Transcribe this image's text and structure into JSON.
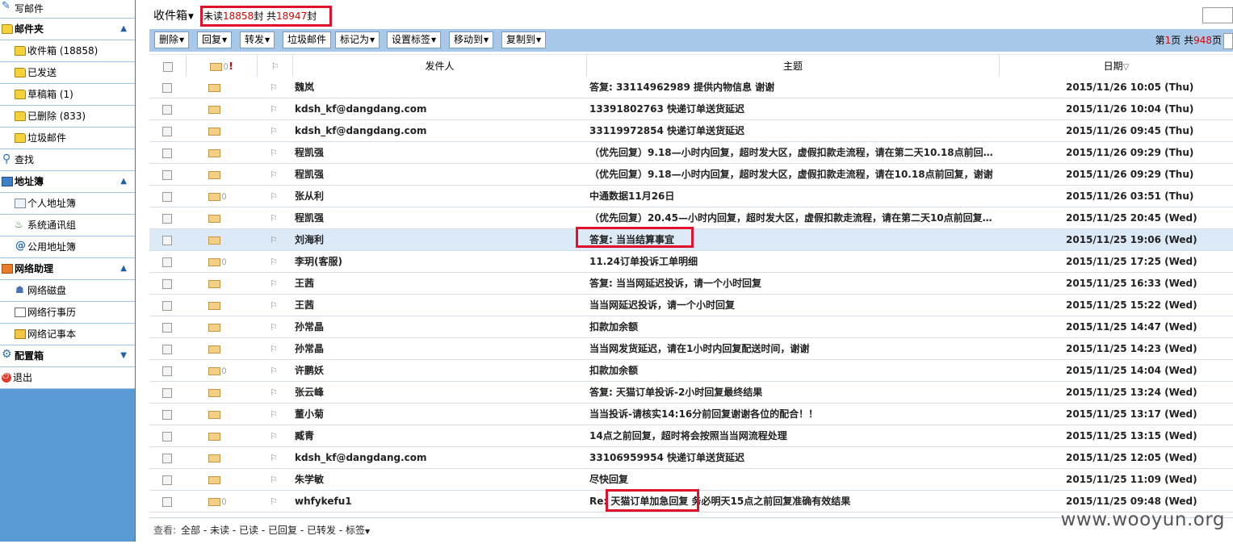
{
  "sidebar": {
    "compose": "写邮件",
    "folders_header": "邮件夹",
    "folders": [
      "收件箱 (18858)",
      "已发送",
      "草稿箱 (1)",
      "已删除 (833)",
      "垃圾邮件"
    ],
    "search": "查找",
    "addressbook_header": "地址簿",
    "addressbook": [
      "个人地址簿",
      "系统通讯组",
      "公用地址簿"
    ],
    "netassist_header": "网络助理",
    "netassist": [
      "网络磁盘",
      "网络行事历",
      "网络记事本"
    ],
    "config_header": "配置箱",
    "logout": "退出"
  },
  "header": {
    "title": "收件箱",
    "unread_prefix": "未读",
    "unread_count": "18858",
    "unread_mid": "封 共",
    "total_count": "18947",
    "total_suffix": "封"
  },
  "toolbar": {
    "delete": "删除",
    "reply": "回复",
    "forward": "转发",
    "spam": "垃圾邮件",
    "mark_as": "标记为",
    "set_tag": "设置标签",
    "move_to": "移动到",
    "copy_to": "复制到",
    "page_prefix": "第",
    "page_num": "1",
    "page_mid": "页 共",
    "page_total": "948",
    "page_suffix": "页"
  },
  "columns": {
    "sender": "发件人",
    "subject": "主题",
    "date": "日期"
  },
  "rows": [
    {
      "from": "魏岚",
      "subject": "答复: 33114962989 提供内物信息 谢谢",
      "date": "2015/11/26 10:05 (Thu)",
      "attach": false
    },
    {
      "from": "kdsh_kf@dangdang.com",
      "subject": "13391802763 快递订单送货延迟",
      "date": "2015/11/26 10:04 (Thu)",
      "attach": false
    },
    {
      "from": "kdsh_kf@dangdang.com",
      "subject": "33119972854 快递订单送货延迟",
      "date": "2015/11/26 09:45 (Thu)",
      "attach": false
    },
    {
      "from": "程凯强",
      "subject": "（优先回复）9.18—小时内回复，超时发大区，虚假扣款走流程，请在第二天10.18点前回...",
      "date": "2015/11/26 09:29 (Thu)",
      "attach": false
    },
    {
      "from": "程凯强",
      "subject": "（优先回复）9.18—小时内回复，超时发大区，虚假扣款走流程，请在10.18点前回复，谢谢",
      "date": "2015/11/26 09:29 (Thu)",
      "attach": false
    },
    {
      "from": "张从利",
      "subject": "中通数据11月26日",
      "date": "2015/11/26 03:51 (Thu)",
      "attach": true
    },
    {
      "from": "程凯强",
      "subject": "（优先回复）20.45—小时内回复，超时发大区，虚假扣款走流程，请在第二天10点前回复...",
      "date": "2015/11/25 20:45 (Wed)",
      "attach": false
    },
    {
      "from": "刘海利",
      "subject": "答复: 当当结算事宜",
      "date": "2015/11/25 19:06 (Wed)",
      "attach": false
    },
    {
      "from": "李玥(客服)",
      "subject": "11.24订单投诉工单明细",
      "date": "2015/11/25 17:25 (Wed)",
      "attach": true
    },
    {
      "from": "王茜",
      "subject": "答复: 当当网延迟投诉，请一个小时回复",
      "date": "2015/11/25 16:33 (Wed)",
      "attach": false
    },
    {
      "from": "王茜",
      "subject": "当当网延迟投诉，请一个小时回复",
      "date": "2015/11/25 15:22 (Wed)",
      "attach": false
    },
    {
      "from": "孙常晶",
      "subject": "扣款加余额",
      "date": "2015/11/25 14:47 (Wed)",
      "attach": false
    },
    {
      "from": "孙常晶",
      "subject": "当当网发货延迟，请在1小时内回复配送时间，谢谢",
      "date": "2015/11/25 14:23 (Wed)",
      "attach": false
    },
    {
      "from": "许鹏妖",
      "subject": "扣款加余额",
      "date": "2015/11/25 14:04 (Wed)",
      "attach": true
    },
    {
      "from": "张云峰",
      "subject": "答复: 天猫订单投诉-2小时回复最终结果",
      "date": "2015/11/25 13:24 (Wed)",
      "attach": false
    },
    {
      "from": "董小菊",
      "subject": "当当投诉-请核实14:16分前回复谢谢各位的配合！！",
      "date": "2015/11/25 13:17 (Wed)",
      "attach": false
    },
    {
      "from": "臧青",
      "subject": "14点之前回复，超时将会按照当当网流程处理",
      "date": "2015/11/25 13:15 (Wed)",
      "attach": false
    },
    {
      "from": "kdsh_kf@dangdang.com",
      "subject": "33106959954 快递订单送货延迟",
      "date": "2015/11/25 12:05 (Wed)",
      "attach": false
    },
    {
      "from": "朱学敏",
      "subject": "尽快回复",
      "date": "2015/11/25 11:09 (Wed)",
      "attach": false
    },
    {
      "from": "whfykefu1",
      "subject": "Re: 天猫订单加急回复 务必明天15点之前回复准确有效结果",
      "date": "2015/11/25 09:48 (Wed)",
      "attach": true
    }
  ],
  "selected_row": 7,
  "footer": {
    "view_label": "查看:",
    "all": "全部",
    "unread": "未读",
    "read": "已读",
    "replied": "已回复",
    "forwarded": "已转发",
    "tags": "标签",
    "sep": " - "
  },
  "watermark": "www.wooyun.org"
}
